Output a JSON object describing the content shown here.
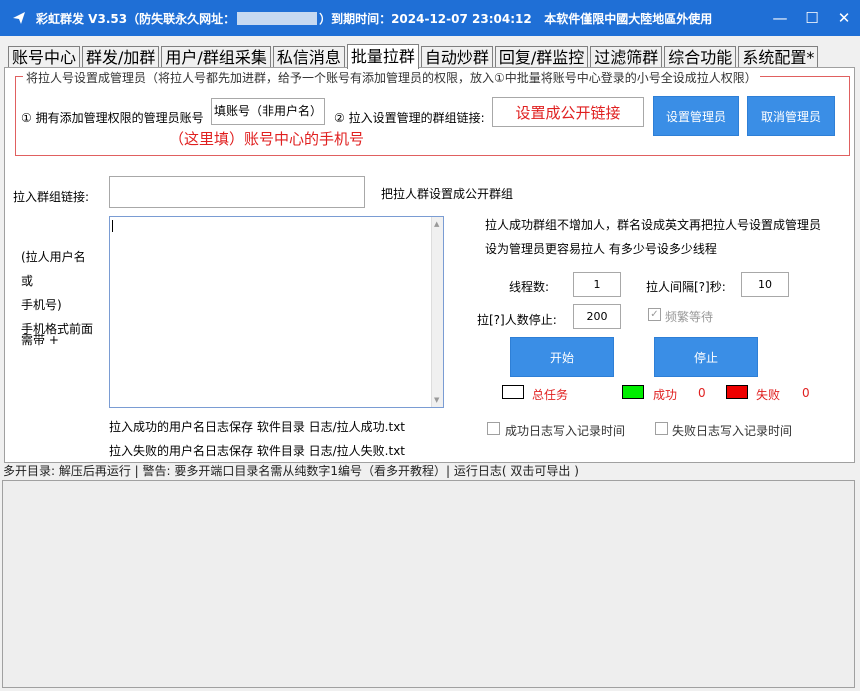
{
  "window": {
    "title_prefix": "彩虹群发 V3.53（防失联永久网址：",
    "title_suffix": "）到期时间：2024-12-07 23:04:12   本软件僅限中國大陸地區外使用",
    "minimize": "—",
    "maximize": "☐",
    "close": "✕"
  },
  "tabs": [
    {
      "label": "账号中心"
    },
    {
      "label": "群发/加群"
    },
    {
      "label": "用户/群组采集"
    },
    {
      "label": "私信消息"
    },
    {
      "label": "批量拉群"
    },
    {
      "label": "自动炒群"
    },
    {
      "label": "回复/群监控"
    },
    {
      "label": "过滤筛群"
    },
    {
      "label": "综合功能"
    },
    {
      "label": "系统配置*"
    }
  ],
  "admin_group": {
    "legend": "将拉人号设置成管理员（将拉人号都先加进群，给予一个账号有添加管理员的权限，放入①中批量将账号中心登录的小号全设成拉人权限）",
    "label1": "① 拥有添加管理权限的管理员账号",
    "admin_input_placeholder": "填账号（非用户名）",
    "label2": "② 拉入设置管理的群组链接:",
    "link_input_hint": "设置成公开链接",
    "set_admin_btn": "设置管理员",
    "cancel_admin_btn": "取消管理员",
    "fill_hint": "（这里填）账号中心的手机号"
  },
  "main": {
    "group_link_label": "拉入群组链接:",
    "group_link_value": "",
    "public_hint": "把拉人群设置成公开群组",
    "user_label_1": "(拉人用户名",
    "user_label_2": "或",
    "user_label_3": "手机号)",
    "user_label_4": "手机格式前面",
    "user_label_5": "需带 +",
    "users_textarea_value": "",
    "tip_1": "拉人成功群组不增加人，群名设成英文再把拉人号设置成管理员",
    "tip_2": "设为管理员更容易拉人  有多少号设多少线程",
    "threads_label": "线程数:",
    "threads_value": "1",
    "interval_label": "拉人间隔[?]秒:",
    "interval_value": "10",
    "stop_label": "拉[?]人数停止:",
    "stop_value": "200",
    "frequent_wait_label": "频繁等待",
    "start_btn": "开始",
    "stop_btn": "停止",
    "total_label": "总任务",
    "success_label": "成功",
    "success_count": "0",
    "fail_label": "失败",
    "fail_count": "0",
    "log_success": "拉入成功的用户名日志保存 软件目录 日志/拉人成功.txt",
    "log_fail": "拉入失败的用户名日志保存 软件目录 日志/拉人失败.txt",
    "chk_success_time": "成功日志写入记录时间",
    "chk_fail_time": "失败日志写入记录时间"
  },
  "status_bar": {
    "text": "多开目录: 解压后再运行 | 警告: 要多开端口目录名需从纯数字1编号（看多开教程）| 运行日志( 双击可导出 )"
  },
  "colors": {
    "titlebar": "#1f6fd6",
    "accent_button": "#3a8ee6",
    "hint_red": "#e02020",
    "success_swatch": "#00ee00",
    "fail_swatch": "#ee0000"
  }
}
